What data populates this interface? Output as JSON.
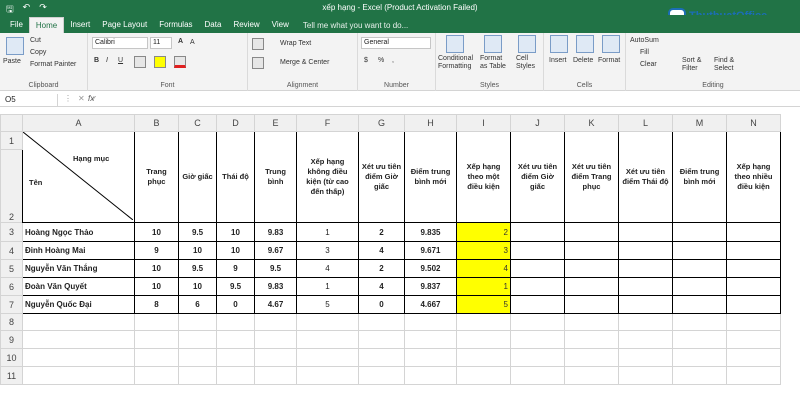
{
  "title_bar": {
    "title": "xếp hạng - Excel (Product Activation Failed)",
    "qat": [
      "save-icon",
      "undo-icon",
      "redo-icon"
    ]
  },
  "logo": {
    "brand": "ThuthuatOffice",
    "tagline": "TRI KỶ CỦA DÂN CÔNG SỞ"
  },
  "tabs": [
    "File",
    "Home",
    "Insert",
    "Page Layout",
    "Formulas",
    "Data",
    "Review",
    "View"
  ],
  "tell_me": "Tell me what you want to do...",
  "ribbon": {
    "clipboard": {
      "paste": "Paste",
      "cut": "Cut",
      "copy": "Copy",
      "format_painter": "Format Painter",
      "label": "Clipboard"
    },
    "font": {
      "name": "Calibri",
      "size": "11",
      "bold": "B",
      "italic": "I",
      "underline": "U",
      "grow": "A",
      "shrink": "A",
      "label": "Font"
    },
    "alignment": {
      "wrap": "Wrap Text",
      "merge": "Merge & Center",
      "label": "Alignment"
    },
    "number": {
      "format": "General",
      "currency": "$",
      "percent": "%",
      "comma": ",",
      "label": "Number"
    },
    "styles": {
      "cond": "Conditional Formatting",
      "table": "Format as Table",
      "cell": "Cell Styles",
      "label": "Styles"
    },
    "cells": {
      "insert": "Insert",
      "delete": "Delete",
      "format": "Format",
      "label": "Cells"
    },
    "editing": {
      "autosum": "AutoSum",
      "fill": "Fill",
      "clear": "Clear",
      "sort": "Sort & Filter",
      "find": "Find & Select",
      "label": "Editing"
    }
  },
  "formula_bar": {
    "name_box": "O5",
    "fx": "fx",
    "value": ""
  },
  "columns": [
    "A",
    "B",
    "C",
    "D",
    "E",
    "F",
    "G",
    "H",
    "I",
    "J",
    "K",
    "L",
    "M",
    "N"
  ],
  "header": {
    "hang_muc": "Hạng mục",
    "ten": "Tên",
    "b": "Trang phục",
    "c": "Giờ giấc",
    "d": "Thái độ",
    "e": "Trung bình",
    "f": "Xếp hạng không điều kiện (từ cao đến thấp)",
    "g": "Xét ưu tiên điểm Giờ giấc",
    "h": "Điểm trung bình mới",
    "i": "Xếp hạng theo một điều kiện",
    "j": "Xét ưu tiên điểm Giờ giấc",
    "k": "Xét ưu tiên điểm Trang phục",
    "l": "Xét ưu tiên điểm Thái độ",
    "m": "Điểm trung bình mới",
    "n": "Xếp hạng theo nhiều điều kiện"
  },
  "rows": [
    {
      "name": "Hoàng Ngọc Thảo",
      "b": "10",
      "c": "9.5",
      "d": "10",
      "e": "9.83",
      "f": "1",
      "g": "2",
      "h": "9.835",
      "i": "2"
    },
    {
      "name": "Đinh Hoàng Mai",
      "b": "9",
      "c": "10",
      "d": "10",
      "e": "9.67",
      "f": "3",
      "g": "4",
      "h": "9.671",
      "i": "3"
    },
    {
      "name": "Nguyễn Văn Thắng",
      "b": "10",
      "c": "9.5",
      "d": "9",
      "e": "9.5",
      "f": "4",
      "g": "2",
      "h": "9.502",
      "i": "4"
    },
    {
      "name": "Đoàn Văn Quyết",
      "b": "10",
      "c": "10",
      "d": "9.5",
      "e": "9.83",
      "f": "1",
      "g": "4",
      "h": "9.837",
      "i": "1"
    },
    {
      "name": "Nguyễn Quốc Đại",
      "b": "8",
      "c": "6",
      "d": "0",
      "e": "4.67",
      "f": "5",
      "g": "0",
      "h": "4.667",
      "i": "5"
    }
  ],
  "row_numbers": [
    "1",
    "2",
    "3",
    "4",
    "5",
    "6",
    "7",
    "8",
    "9",
    "10",
    "11"
  ],
  "colors": {
    "excel_green": "#217346",
    "highlight": "#ffff00"
  }
}
